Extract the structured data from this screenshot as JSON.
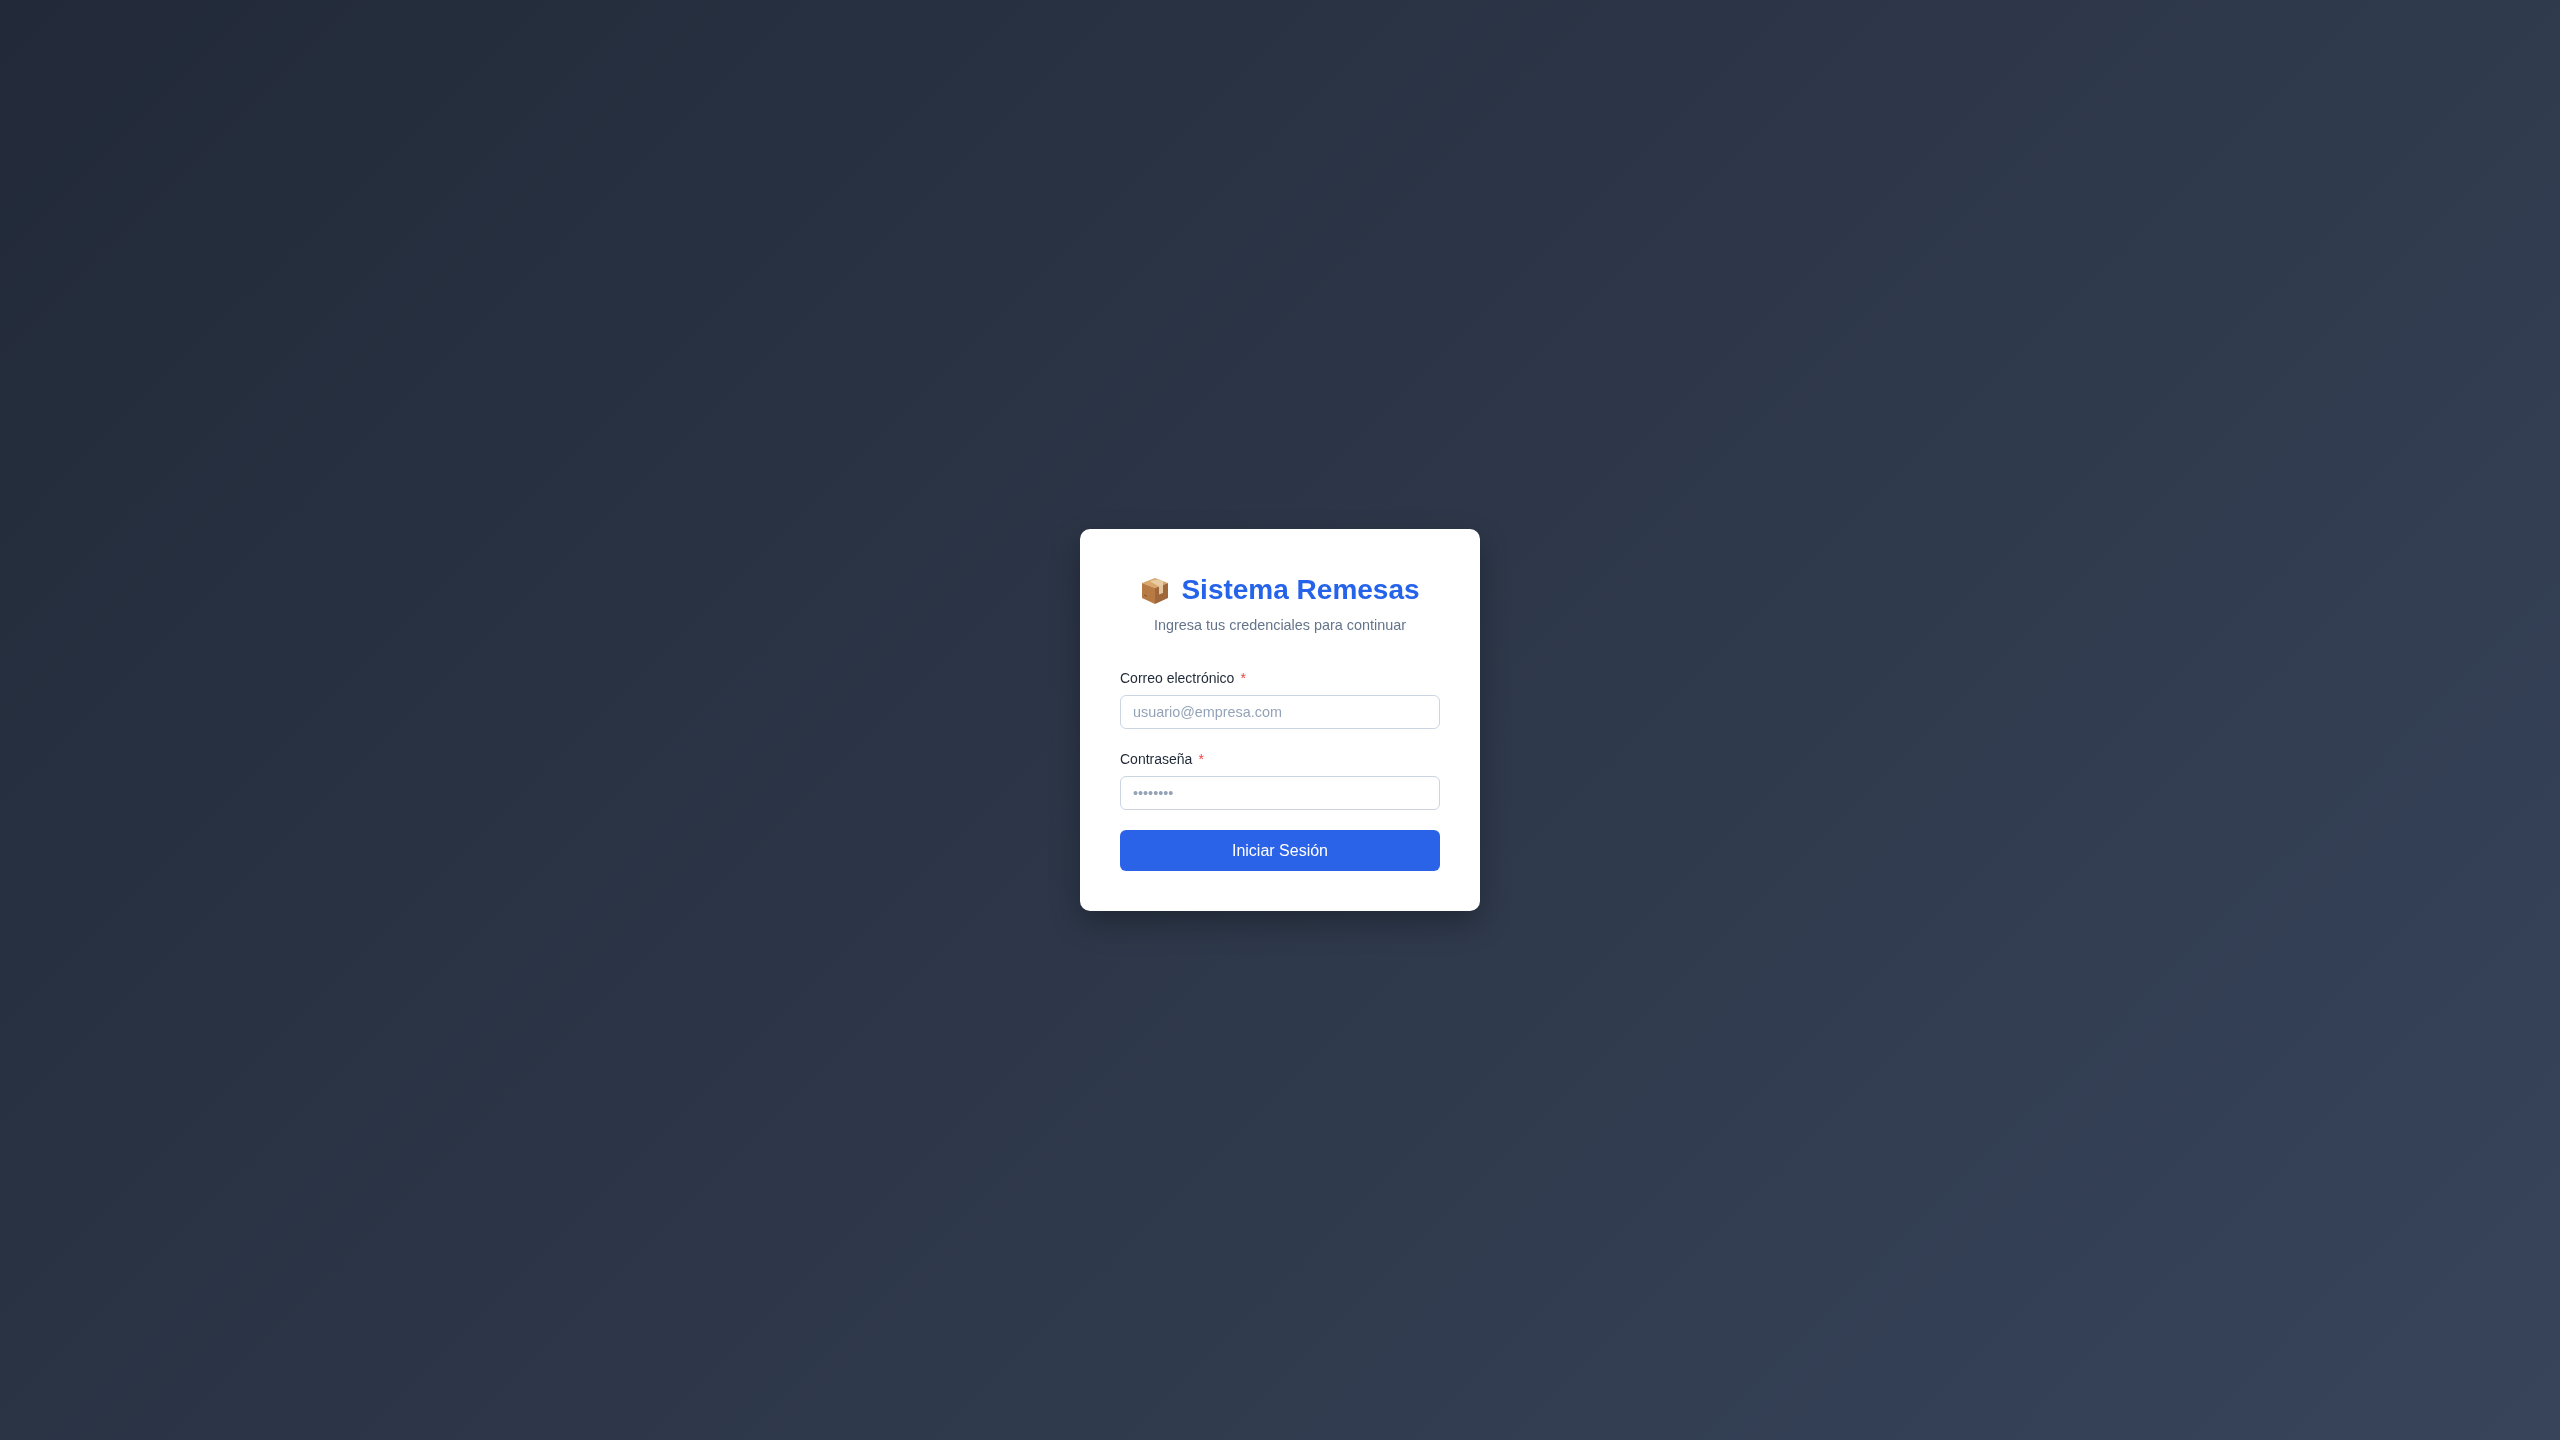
{
  "login": {
    "title": "Sistema Remesas",
    "subtitle": "Ingresa tus credenciales para continuar",
    "email_field": {
      "label": "Correo electrónico",
      "required_mark": "*",
      "placeholder": "usuario@empresa.com"
    },
    "password_field": {
      "label": "Contraseña",
      "required_mark": "*",
      "placeholder": "••••••••"
    },
    "submit_button": "Iniciar Sesión"
  }
}
